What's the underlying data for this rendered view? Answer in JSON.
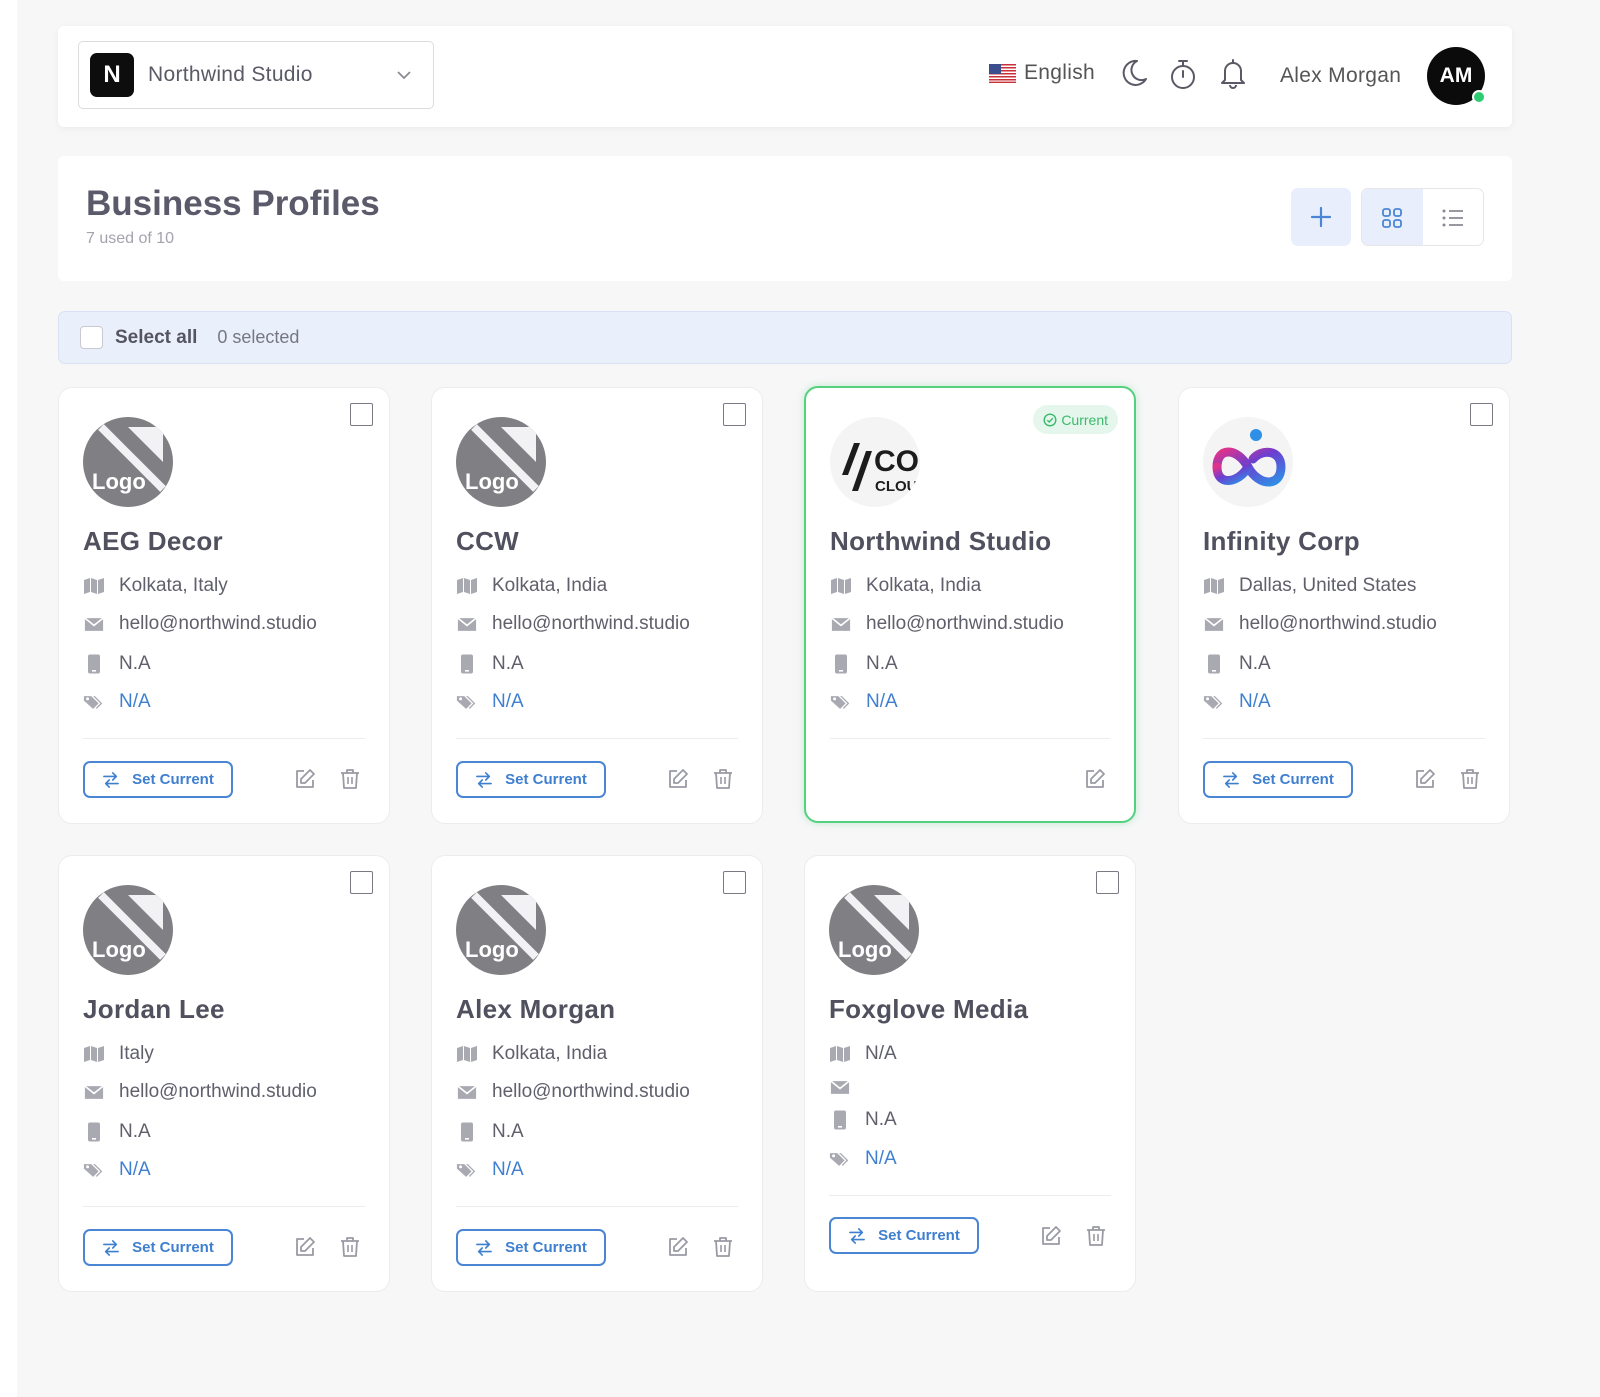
{
  "topbar": {
    "business_initial": "N",
    "business_name": "Northwind Studio",
    "language": "English",
    "user_name": "Alex Morgan",
    "user_initials": "AM",
    "icons": [
      "chevron-down-icon",
      "us-flag-icon",
      "moon-icon",
      "timer-icon",
      "bell-icon"
    ]
  },
  "header": {
    "title": "Business Profiles",
    "subtitle": "7 used of 10"
  },
  "select_bar": {
    "label": "Select all",
    "count": "0 selected"
  },
  "colors": {
    "accent": "#3f7fd0",
    "current_border": "#55d07f",
    "current_text": "#3aba6a"
  },
  "cards": [
    {
      "name": "AEG Decor",
      "location": "Kolkata, Italy",
      "email": "hello@northwind.studio",
      "phone": "N.A",
      "tag": "N/A",
      "logo_label": "Logo",
      "set_current": "Set Current"
    },
    {
      "name": "CCW",
      "location": "Kolkata, India",
      "email": "hello@northwind.studio",
      "phone": "N.A",
      "tag": "N/A",
      "logo_label": "Logo",
      "set_current": "Set Current"
    },
    {
      "name": "Northwind Studio",
      "location": "Kolkata, India",
      "email": "hello@northwind.studio",
      "phone": "N.A",
      "tag": "N/A",
      "current_label": "Current",
      "logo_text_top": "CO",
      "logo_text_bottom": "CLOU"
    },
    {
      "name": "Infinity Corp",
      "location": "Dallas, United States",
      "email": "hello@northwind.studio",
      "phone": "N.A",
      "tag": "N/A",
      "set_current": "Set Current"
    },
    {
      "name": "Jordan Lee",
      "location": "Italy",
      "email": "hello@northwind.studio",
      "phone": "N.A",
      "tag": "N/A",
      "logo_label": "Logo",
      "set_current": "Set Current"
    },
    {
      "name": "Alex Morgan",
      "location": "Kolkata, India",
      "email": "hello@northwind.studio",
      "phone": "N.A",
      "tag": "N/A",
      "logo_label": "Logo",
      "set_current": "Set Current"
    },
    {
      "name": "Foxglove Media",
      "location": "N/A",
      "email": "",
      "phone": "N.A",
      "tag": "N/A",
      "logo_label": "Logo",
      "set_current": "Set Current"
    }
  ]
}
